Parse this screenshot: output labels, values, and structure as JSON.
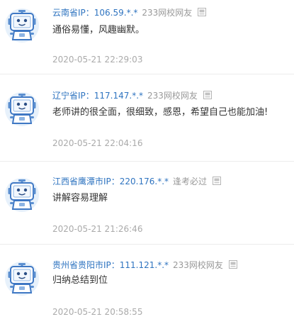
{
  "comments": [
    {
      "location": "云南省IP：106.59.*.*",
      "nickname": "233网校网友",
      "content": "通俗易懂，风趣幽默。",
      "time": "2020-05-21 22:29:03"
    },
    {
      "location": "辽宁省IP：117.147.*.*",
      "nickname": "233网校网友",
      "content": "老师讲的很全面，很细致，感恩，希望自己也能加油!",
      "time": "2020-05-21 22:04:16"
    },
    {
      "location": "江西省鹰潭市IP：220.176.*.*",
      "nickname": "逢考必过",
      "content": "讲解容易理解",
      "time": "2020-05-21 21:26:46"
    },
    {
      "location": "贵州省贵阳市IP：111.121.*.*",
      "nickname": "233网校网友",
      "content": "归纳总结到位",
      "time": "2020-05-21 20:58:55"
    }
  ],
  "icons": {
    "avatar": "robot-avatar-icon",
    "report": "report-icon"
  },
  "colors": {
    "location": "#2f74c0",
    "nickname": "#999999",
    "content": "#333333",
    "time": "#aaaaaa",
    "divider": "#ececec"
  }
}
